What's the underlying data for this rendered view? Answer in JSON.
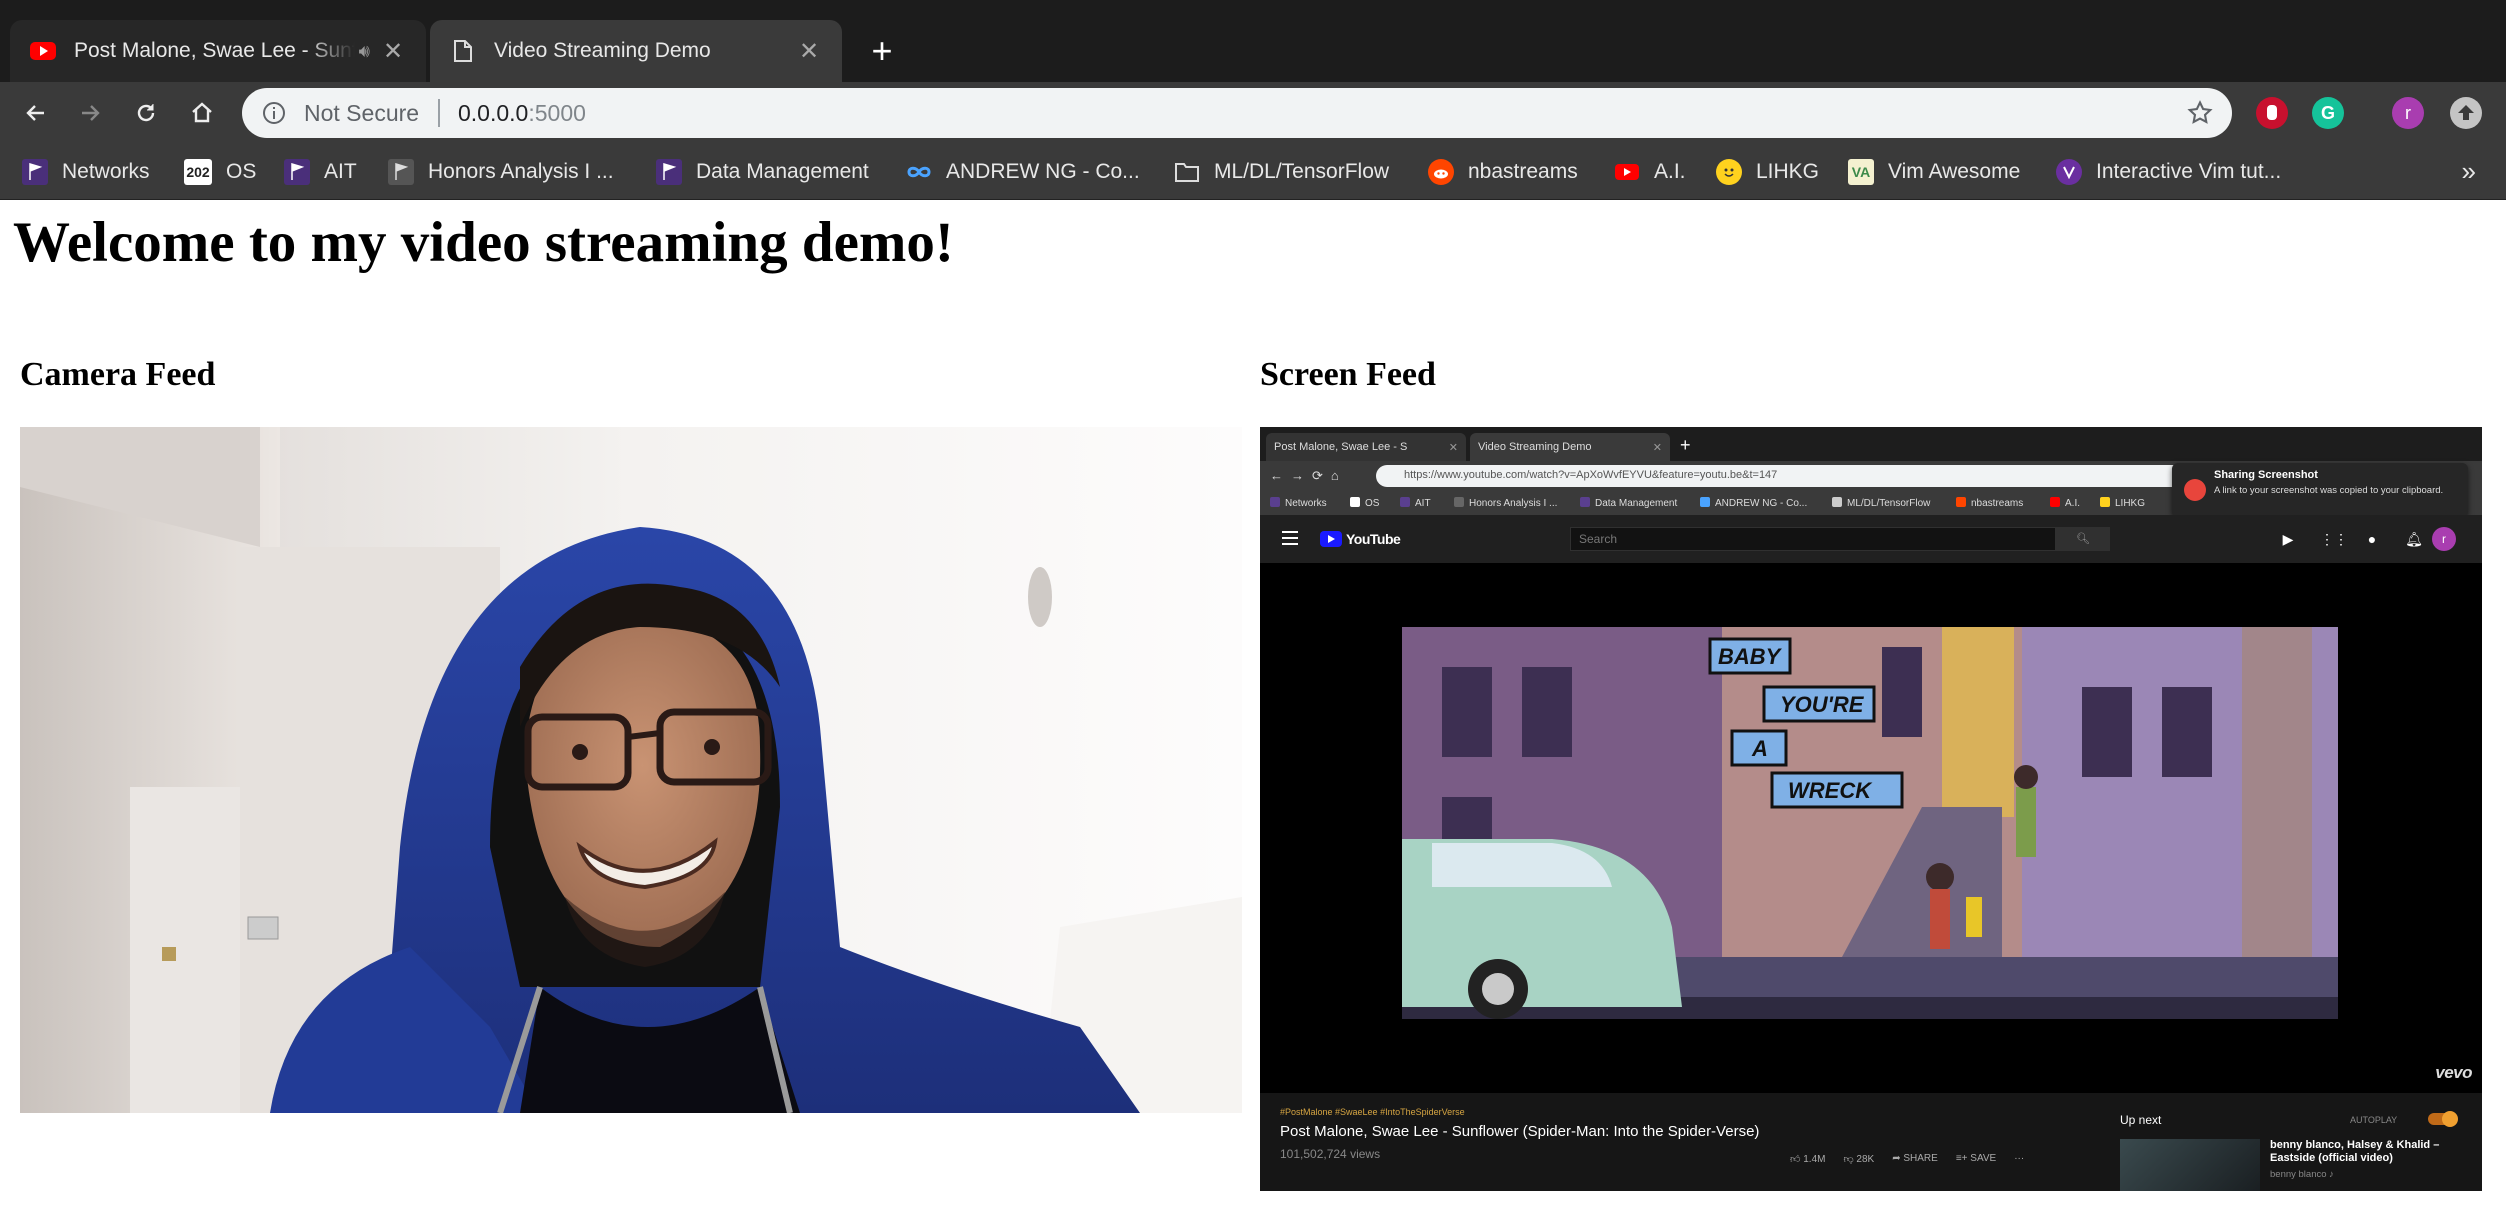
{
  "browser": {
    "tabs": [
      {
        "title": "Post Malone, Swae Lee - Sunflower (Spider-Man: Into the Spider-Verse)",
        "icon": "youtube-icon",
        "active": false,
        "audio": true
      },
      {
        "title": "Video Streaming Demo",
        "icon": "page-icon",
        "active": true,
        "audio": false
      }
    ],
    "security_label": "Not Secure",
    "url_host": "0.0.0.0",
    "url_port": ":5000",
    "bookmarks": [
      {
        "label": "Networks",
        "icon": "purple-pennant-icon"
      },
      {
        "label": "OS",
        "icon": "202-badge-icon",
        "badge": "202"
      },
      {
        "label": "AIT",
        "icon": "purple-pennant-icon"
      },
      {
        "label": "Honors Analysis I ...",
        "icon": "gray-pennant-icon"
      },
      {
        "label": "Data Management",
        "icon": "purple-pennant-icon"
      },
      {
        "label": "ANDREW NG - Co...",
        "icon": "coursera-infinity-icon"
      },
      {
        "label": "ML/DL/TensorFlow",
        "icon": "folder-icon"
      },
      {
        "label": "nbastreams",
        "icon": "reddit-icon"
      },
      {
        "label": "A.I.",
        "icon": "youtube-icon"
      },
      {
        "label": "LIHKG",
        "icon": "smiley-icon"
      },
      {
        "label": "Vim Awesome",
        "icon": "va-badge-icon",
        "badge": "VA"
      },
      {
        "label": "Interactive Vim tut...",
        "icon": "purple-circle-icon"
      }
    ],
    "more_bookmarks": "»",
    "avatar_letter": "r",
    "colors": {
      "tabbar": "#1c1c1c",
      "toolbar": "#3a3a3a",
      "omnibox": "#f1f3f4"
    }
  },
  "page": {
    "title": "Welcome to my video streaming demo!",
    "camera_title": "Camera Feed",
    "screen_title": "Screen Feed"
  },
  "screen_feed": {
    "tabs": [
      "Post Malone, Swae Lee - S",
      "Video Streaming Demo"
    ],
    "url": "https://www.youtube.com/watch?v=ApXoWvfEYVU&feature=youtu.be&t=147",
    "bookmarks": [
      "Networks",
      "OS",
      "AIT",
      "Honors Analysis I ...",
      "Data Management",
      "ANDREW NG - Co...",
      "ML/DL/TensorFlow",
      "nbastreams",
      "A.I.",
      "LIHKG"
    ],
    "notification": {
      "title": "Sharing Screenshot",
      "body": "A link to your screenshot was copied to your clipboard."
    },
    "youtube": {
      "logo": "YouTube",
      "search_placeholder": "Search",
      "avatar_letter": "r",
      "video_captions": [
        "BABY",
        "YOU'RE",
        "A",
        "WRECK"
      ],
      "watermark": "vevo",
      "tags": "#PostMalone #SwaeLee #IntoTheSpiderVerse",
      "video_title": "Post Malone, Swae Lee - Sunflower (Spider-Man: Into the Spider-Verse)",
      "views": "101,502,724 views",
      "likes": "1.4M",
      "dislikes": "28K",
      "share": "SHARE",
      "save": "SAVE",
      "up_next": "Up next",
      "autoplay": "AUTOPLAY",
      "next_title": "benny blanco, Halsey & Khalid – Eastside (official video)",
      "next_channel": "benny blanco ♪"
    }
  }
}
